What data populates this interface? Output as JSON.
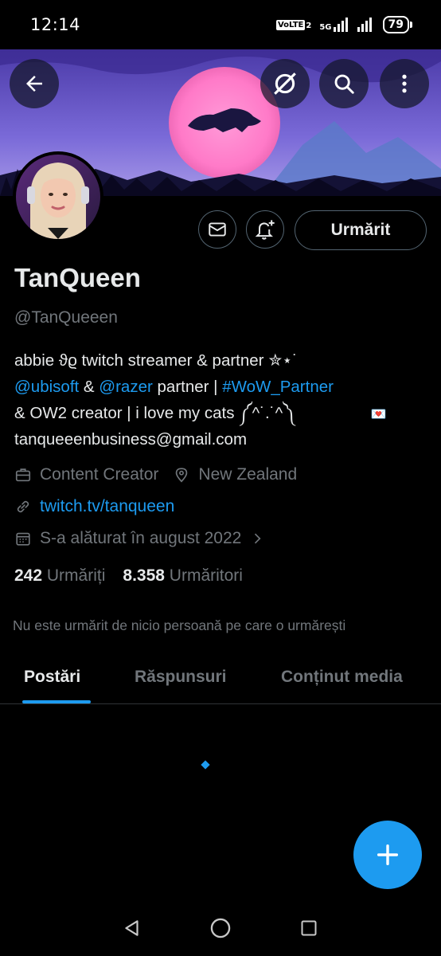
{
  "status_bar": {
    "time": "12:14",
    "volte": "VoLTE",
    "volte_sub": "2",
    "network": "5G",
    "battery": "79"
  },
  "profile": {
    "name": "TanQueen",
    "handle": "@TanQueeen",
    "follow_label": "Urmărit"
  },
  "bio": {
    "line1": "abbie ϑϱ twitch streamer & partner ✮⋆˙",
    "mention1": "@ubisoft",
    "amp": " & ",
    "mention2": "@razer",
    "partner_text": " partner | ",
    "hashtag": "#WoW_Partner",
    "line3": "& OW2 creator | i love my cats  ༼^˙.˙^༽",
    "heart_emoji": "💌",
    "line4": "tanqueeenbusiness@gmail.com"
  },
  "meta": {
    "category": "Content Creator",
    "location": "New Zealand",
    "link": "twitch.tv/tanqueen",
    "joined": "S-a alăturat în august 2022"
  },
  "stats": {
    "following_count": "242",
    "following_label": "Urmăriți",
    "followers_count": "8.358",
    "followers_label": "Urmăritori"
  },
  "mutual_text": "Nu este urmărit de nicio persoană pe care o urmărești",
  "tabs": [
    {
      "label": "Postări",
      "active": true
    },
    {
      "label": "Răspunsuri",
      "active": false
    },
    {
      "label": "Conținut media",
      "active": false
    }
  ],
  "colors": {
    "accent": "#1d9bf0",
    "background": "#000000",
    "muted": "#71767b",
    "text": "#e7e9ea"
  }
}
